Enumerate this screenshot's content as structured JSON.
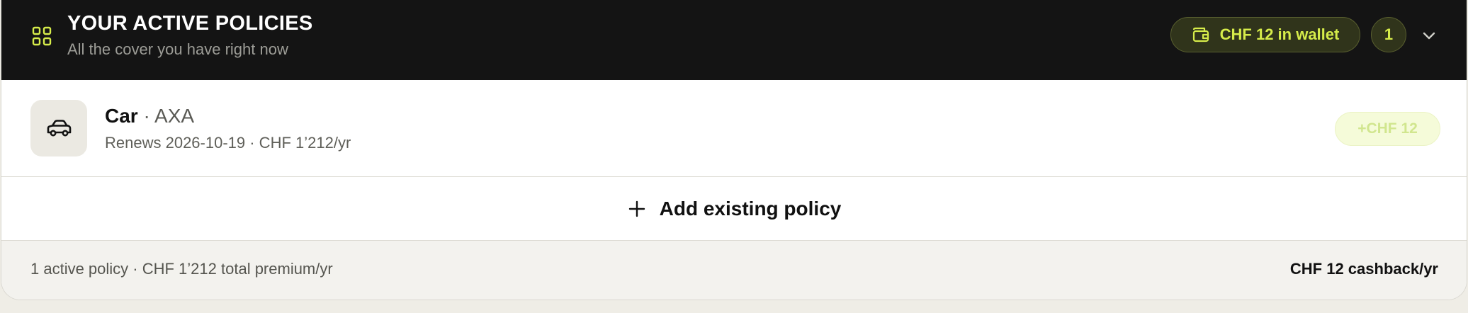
{
  "header": {
    "icon": "grid-icon",
    "title": "YOUR ACTIVE POLICIES",
    "subtitle": "All the cover you have right now",
    "wallet_label": "CHF 12 in wallet",
    "wallet_icon": "wallet-icon",
    "policy_count": "1",
    "expand_icon": "chevron-down-icon"
  },
  "policies": [
    {
      "icon": "car-icon",
      "type": "Car",
      "separator": " · ",
      "insurer": "AXA",
      "meta": "Renews 2026-10-19 · CHF 1’212/yr",
      "cashback": "+CHF 12"
    }
  ],
  "add_policy": {
    "icon": "plus-icon",
    "label": "Add existing policy"
  },
  "footer": {
    "summary": "1 active policy · CHF 1’212 total premium/yr",
    "cashback_total": "CHF 12 cashback/yr"
  },
  "colors": {
    "header_bg": "#141414",
    "accent": "#d6ec4a",
    "page_bg": "#efede6"
  }
}
